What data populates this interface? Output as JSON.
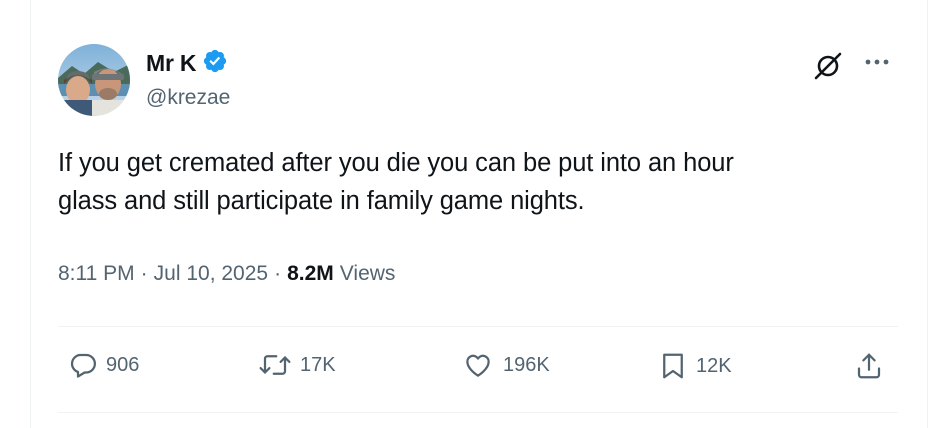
{
  "author": {
    "display_name": "Mr K",
    "handle": "@krezae",
    "verified": true,
    "verified_color": "#1d9bf0"
  },
  "tweet": {
    "text_line1": "If you get cremated after you die you can be put into an hour",
    "text_line2": "glass and still participate in family game nights."
  },
  "meta": {
    "time": "8:11 PM",
    "sep1": "·",
    "date": "Jul 10, 2025",
    "sep2": "·",
    "views_count": "8.2M",
    "views_label": "Views"
  },
  "actions": {
    "replies": "906",
    "reposts": "17K",
    "likes": "196K",
    "bookmarks": "12K"
  },
  "icons": [
    "grok-icon",
    "more-icon",
    "reply-icon",
    "repost-icon",
    "like-icon",
    "bookmark-icon",
    "share-icon",
    "verified-badge-icon"
  ],
  "colors": {
    "text": "#0f1419",
    "secondary": "#536471",
    "divider": "#eff3f4"
  }
}
